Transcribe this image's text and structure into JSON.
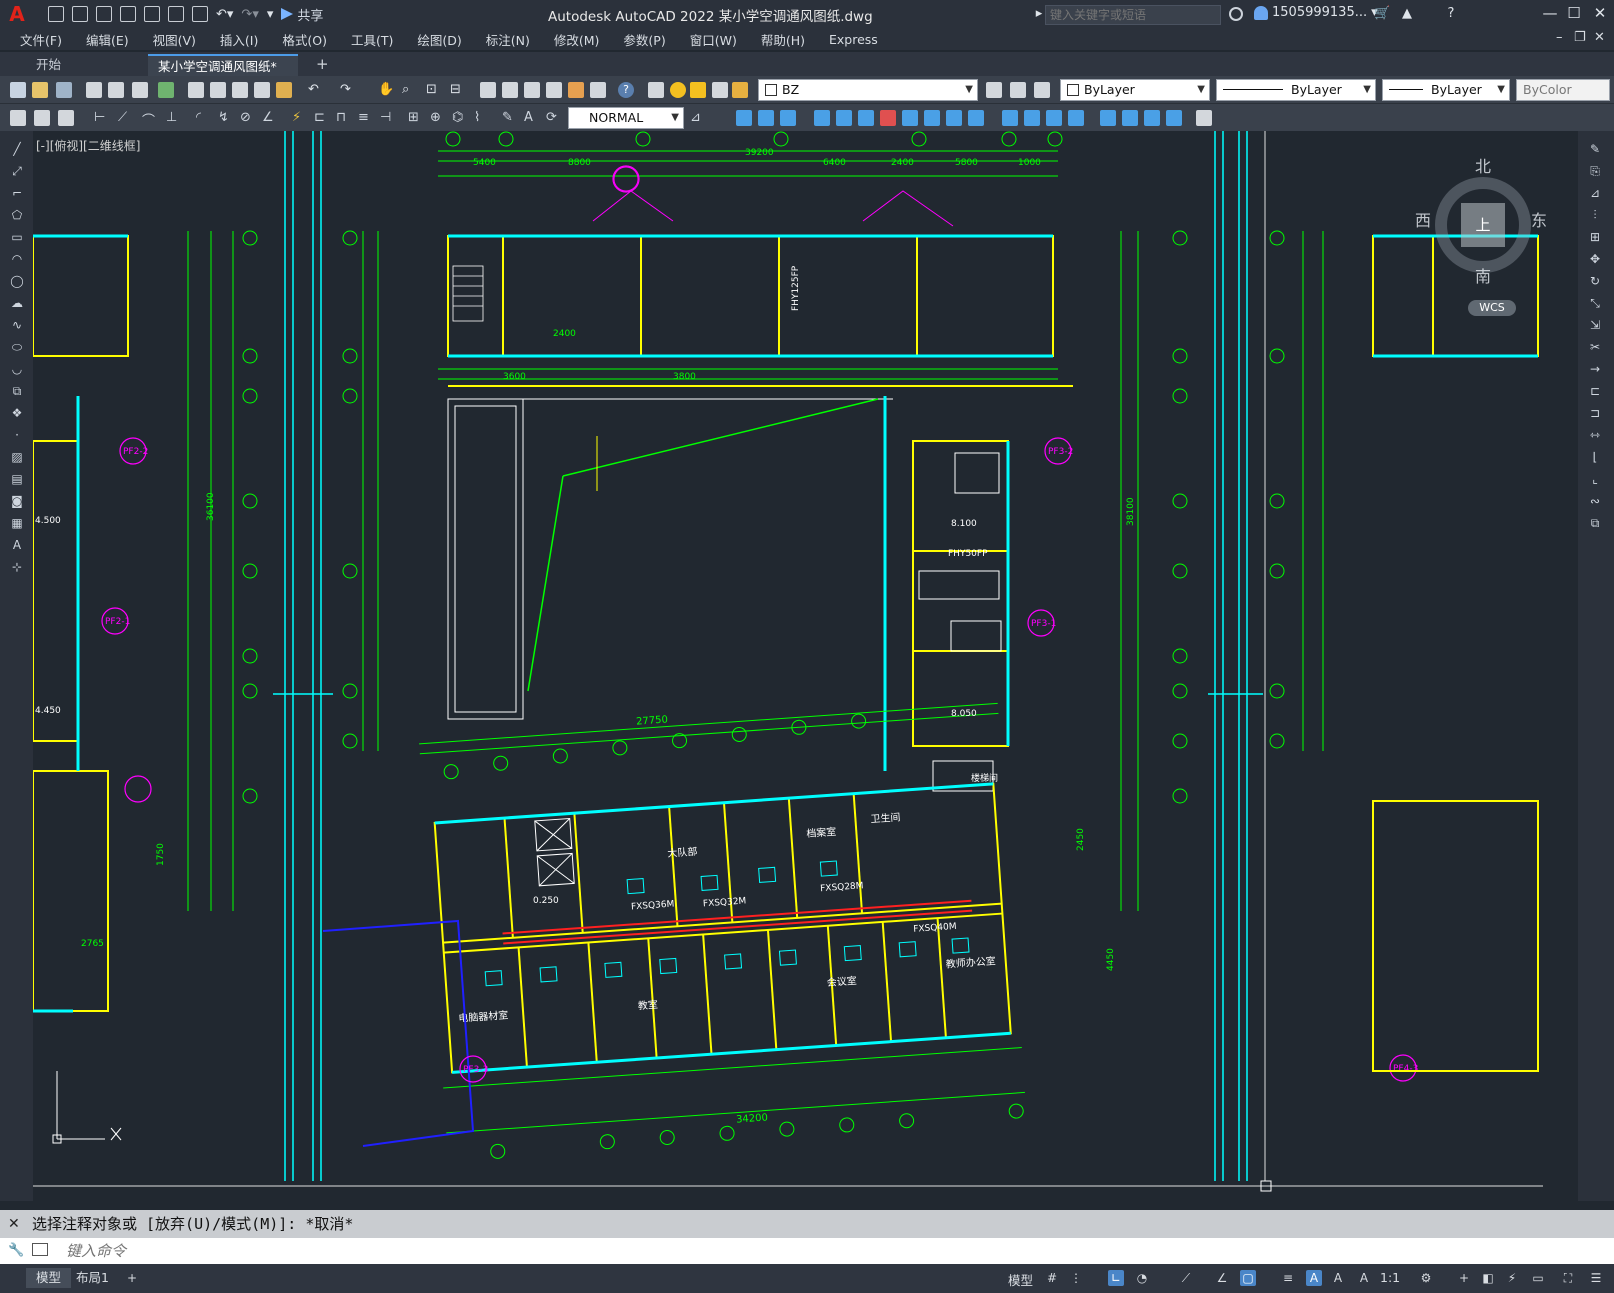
{
  "app": {
    "title": "Autodesk AutoCAD 2022    某小学空调通风图纸.dwg",
    "share_label": "共享",
    "search_placeholder": "键入关键字或短语",
    "user_name": "1505999135...",
    "logo_letter": "A"
  },
  "menu": [
    "文件(F)",
    "编辑(E)",
    "视图(V)",
    "插入(I)",
    "格式(O)",
    "工具(T)",
    "绘图(D)",
    "标注(N)",
    "修改(M)",
    "参数(P)",
    "窗口(W)",
    "帮助(H)",
    "Express"
  ],
  "tabs": [
    {
      "label": "开始"
    },
    {
      "label": "某小学空调通风图纸*"
    }
  ],
  "toolbar": {
    "layer_name": "BZ",
    "color": "ByLayer",
    "linetype": "ByLayer",
    "lineweight": "ByLayer",
    "plotstyle": "ByColor",
    "dimstyle": "NORMAL"
  },
  "viewport_label": "[-][俯视][二维线框]",
  "viewcube": {
    "top": "上",
    "north": "北",
    "south": "南",
    "east": "东",
    "west": "西",
    "wcs": "WCS"
  },
  "drawing": {
    "dims": [
      "39200",
      "5400",
      "8800",
      "6400",
      "2400",
      "5800",
      "1000",
      "2400",
      "3600",
      "3800",
      "27750",
      "34200",
      "36100",
      "38100",
      "2450",
      "4450",
      "2765",
      "1750"
    ],
    "tags": [
      "PF2-2",
      "PF3-2",
      "PF2-1",
      "PF3-1",
      "PF3-3",
      "PF4-3"
    ],
    "units": [
      "FXSQ36M",
      "FXSQ32M",
      "FXSQ28M",
      "FXSQ40M",
      "FHY50FP",
      "FHY125FP"
    ],
    "rooms": [
      "电脑器材室",
      "教师办公室",
      "会议室",
      "大队部",
      "档案室",
      "卫生间",
      "楼梯间",
      "教室"
    ],
    "levels": [
      "8.100",
      "8.050",
      "4.500",
      "4.450",
      "0.250"
    ]
  },
  "command": {
    "history": "选择注释对象或 [放弃(U)/模式(M)]: *取消*",
    "placeholder": "键入命令"
  },
  "status": {
    "layouts": [
      "模型",
      "布局1"
    ],
    "model_label": "模型",
    "scale": "1:1"
  },
  "colors": {
    "accent": "#4c9ce8",
    "canvas": "#212830",
    "yellow": "#ffff00",
    "green": "#00ff00",
    "cyan": "#00ffff",
    "magenta": "#ff00ff",
    "red": "#ff2020"
  }
}
